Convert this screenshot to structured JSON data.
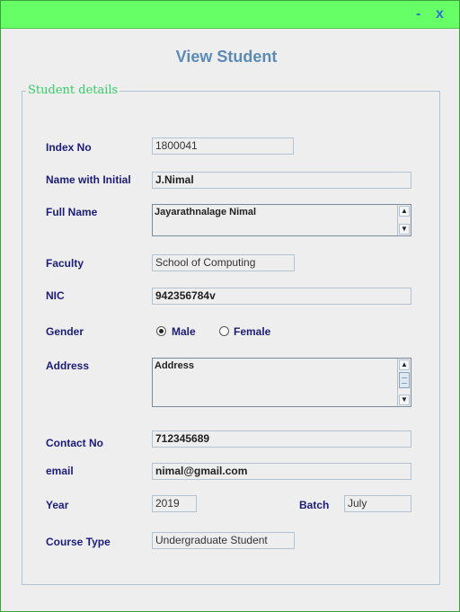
{
  "window": {
    "title": "View Student",
    "minimize_label": "-",
    "close_label": "x"
  },
  "group": {
    "legend": "Student details"
  },
  "fields": {
    "index_no": {
      "label": "Index No",
      "value": "1800041"
    },
    "name_with_initial": {
      "label": "Name with Initial",
      "value": "J.Nimal"
    },
    "full_name": {
      "label": "Full Name",
      "value": "Jayarathnalage Nimal"
    },
    "faculty": {
      "label": "Faculty",
      "value": "School of Computing"
    },
    "nic": {
      "label": "NIC",
      "value": "942356784v"
    },
    "gender": {
      "label": "Gender",
      "options": [
        "Male",
        "Female"
      ],
      "selected": "Male"
    },
    "address": {
      "label": "Address",
      "value": "Address"
    },
    "contact_no": {
      "label": "Contact No",
      "value": "712345689"
    },
    "email": {
      "label": "email",
      "value": "nimal@gmail.com"
    },
    "year": {
      "label": "Year",
      "value": "2019"
    },
    "batch": {
      "label": "Batch",
      "value": "July"
    },
    "course_type": {
      "label": "Course Type",
      "value": "Undergraduate Student"
    }
  },
  "icons": {
    "scroll_up": "▲",
    "scroll_down": "▼"
  },
  "colors": {
    "titlebar": "#66ff66",
    "heading": "#5b8bb5",
    "legend": "#33cc66",
    "label": "#1c1c7a",
    "window_buttons": "#2f6fd6"
  }
}
